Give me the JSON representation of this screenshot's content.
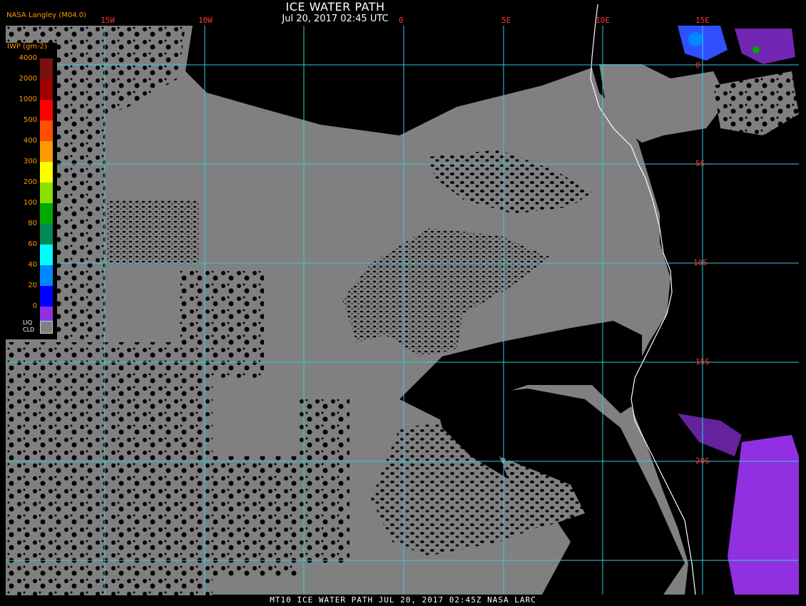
{
  "header": {
    "title": "ICE WATER PATH",
    "subtitle": "Jul 20, 2017 02:45 UTC",
    "provider": "NASA Langley (M04.0)"
  },
  "legend": {
    "title": "IWP (gm-2)",
    "entries": [
      {
        "label": "4000",
        "color": "#7a1010"
      },
      {
        "label": "2000",
        "color": "#a00000"
      },
      {
        "label": "1000",
        "color": "#ff0000"
      },
      {
        "label": "500",
        "color": "#ff5000"
      },
      {
        "label": "400",
        "color": "#ff9900"
      },
      {
        "label": "300",
        "color": "#ffff00"
      },
      {
        "label": "200",
        "color": "#88e000"
      },
      {
        "label": "100",
        "color": "#00aa00"
      },
      {
        "label": "80",
        "color": "#008855"
      },
      {
        "label": "60",
        "color": "#00ffff"
      },
      {
        "label": "40",
        "color": "#0088ff"
      },
      {
        "label": "20",
        "color": "#0000ff"
      },
      {
        "label": "0",
        "color": "#9030e0"
      }
    ],
    "liquid_label_1": "LIQ",
    "liquid_label_2": "CLD",
    "liquid_color": "#808080"
  },
  "map": {
    "grid_color": "#2ed0d8",
    "cloud_color": "#808080",
    "ice_color": "#9030e0",
    "coast_color": "#ffffff",
    "longitude_labels": [
      "15W",
      "10W",
      "0",
      "5E",
      "10E",
      "15E"
    ],
    "latitude_labels": [
      "0",
      "5S",
      "10S",
      "15S",
      "20S"
    ]
  },
  "footer": "MT10  ICE WATER PATH  JUL 20, 2017 02:45Z  NASA LARC"
}
